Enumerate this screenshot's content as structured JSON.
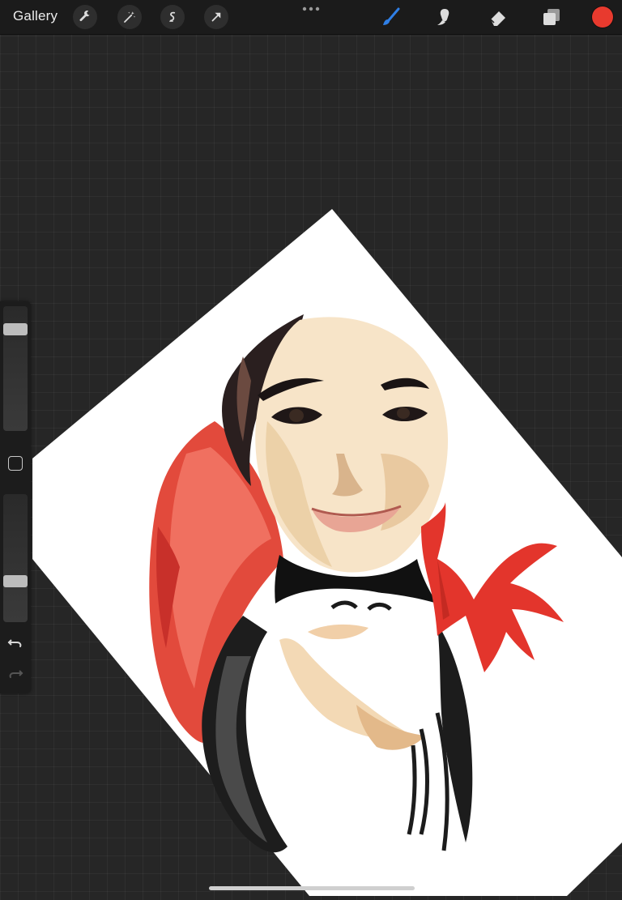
{
  "app": {
    "gallery_label": "Gallery"
  },
  "toolbar": {
    "left_tools": [
      "wrench-icon",
      "magic-wand-icon",
      "selection-icon",
      "transform-arrow-icon"
    ],
    "right_tools": [
      "brush-icon",
      "smudge-icon",
      "eraser-icon",
      "layers-icon"
    ],
    "active_tool": "brush-icon",
    "active_color": "#e83a2e",
    "accent_color": "#2f7fe6"
  },
  "sidebar": {
    "brush_size_level": 0.85,
    "opacity_level": 0.3
  },
  "canvas": {
    "paper_color": "#ffffff",
    "subject": "vector-portrait"
  }
}
